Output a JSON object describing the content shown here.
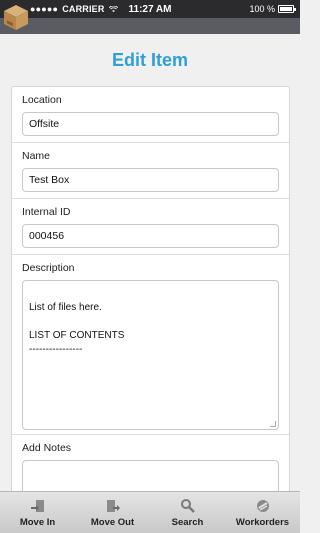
{
  "status_bar": {
    "carrier": "CARRIER",
    "time": "11:27 AM",
    "battery": "100 %"
  },
  "page": {
    "title": "Edit Item"
  },
  "form": {
    "location": {
      "label": "Location",
      "value": "Offsite"
    },
    "name": {
      "label": "Name",
      "value": "Test Box"
    },
    "internal_id": {
      "label": "Internal ID",
      "value": "000456"
    },
    "description": {
      "label": "Description",
      "value": "List of files here.\n\n LIST OF CONTENTS\n----------------"
    },
    "add_notes": {
      "label": "Add Notes",
      "value": ""
    }
  },
  "tab_bar": {
    "tabs": [
      {
        "label": "Move In",
        "icon": "move-in-icon"
      },
      {
        "label": "Move Out",
        "icon": "move-out-icon"
      },
      {
        "label": "Search",
        "icon": "search-icon"
      },
      {
        "label": "Workorders",
        "icon": "workorders-icon"
      }
    ]
  },
  "colors": {
    "title": "#2e9fd8",
    "status_bar": "#2b2b2e",
    "nav_strip": "#5a5b63"
  }
}
